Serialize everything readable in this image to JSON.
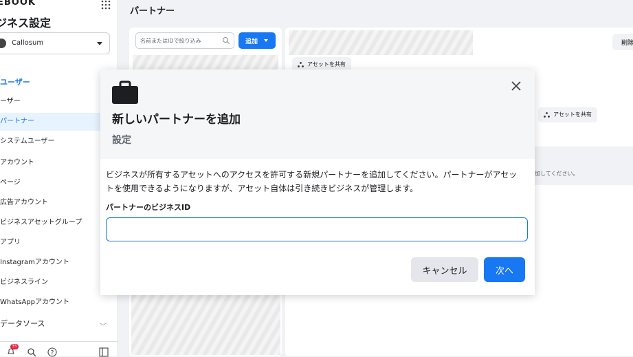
{
  "sidebar": {
    "brand": "EBOOK",
    "title": "ジネス設定",
    "account_name": "Callosum",
    "section_users": "ユーザー",
    "items": [
      {
        "label": "ーザー"
      },
      {
        "label": "パートナー"
      },
      {
        "label": "システムユーザー"
      },
      {
        "label": "アカウント"
      },
      {
        "label": "ページ"
      },
      {
        "label": "広告アカウント"
      },
      {
        "label": "ビジネスアセットグループ"
      },
      {
        "label": "アプリ"
      },
      {
        "label": "Instagramアカウント"
      },
      {
        "label": "ビジネスライン"
      },
      {
        "label": "WhatsAppアカウント"
      },
      {
        "label": "データソース"
      }
    ],
    "notification_count": "35"
  },
  "main": {
    "title": "パートナー",
    "filter_placeholder": "名前またはIDで絞り込み",
    "add_label": "追加",
    "share_label": "アセットを共有",
    "delete_label": "削除",
    "hint_text": "加してください。"
  },
  "dialog": {
    "title": "新しいパートナーを追加",
    "subtitle": "設定",
    "description": "ビジネスが所有するアセットへのアクセスを許可する新規パートナーを追加してください。パートナーがアセットを使用できるようになりますが、アセット自体は引き続きビジネスが管理します。",
    "field_label": "パートナーのビジネスID",
    "field_value": "",
    "cancel_label": "キャンセル",
    "next_label": "次へ"
  },
  "colors": {
    "accent": "#1877f2",
    "active_bg": "#e7f3ff",
    "badge": "#e41e3f"
  },
  "icons": [
    "grid-icon",
    "chevron-down-icon",
    "bell-icon",
    "search-icon",
    "help-icon",
    "panel-icon",
    "share-icon",
    "briefcase-icon",
    "close-icon"
  ]
}
